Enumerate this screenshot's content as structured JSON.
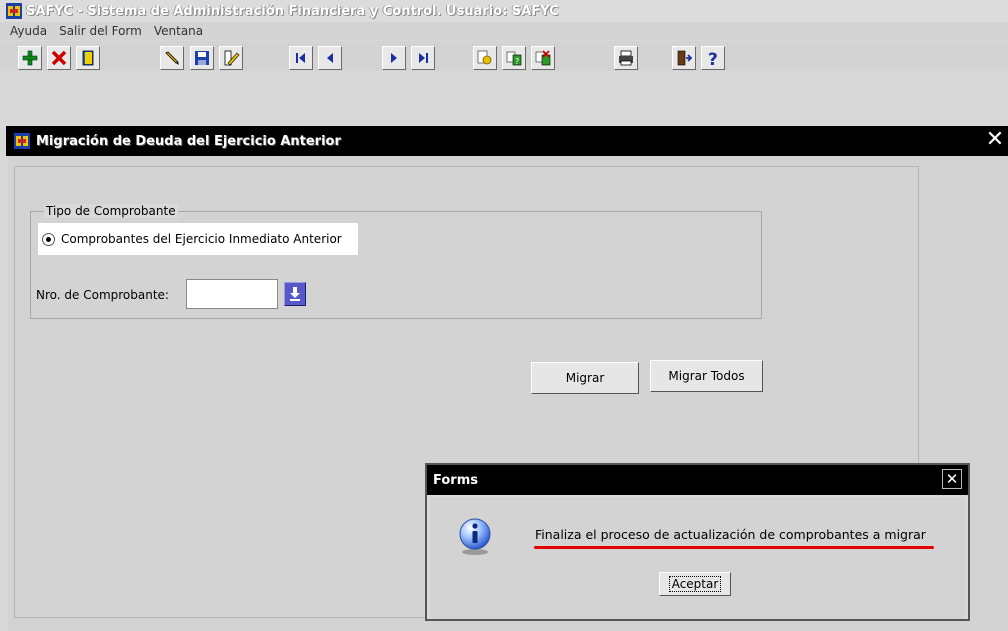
{
  "app": {
    "title": "SAFYC - Sistema de Administración Financiera y Control. Usuario: SAFYC"
  },
  "menu": [
    "Ayuda",
    "Salir del Form",
    "Ventana"
  ],
  "toolbar": {
    "buttons": [
      {
        "name": "insert-record",
        "icon": "green-plus-icon"
      },
      {
        "name": "delete-record",
        "icon": "red-x-icon"
      },
      {
        "name": "query",
        "icon": "book-icon"
      },
      {
        "name": "edit",
        "icon": "pencil-icon"
      },
      {
        "name": "save",
        "icon": "floppy-disk-icon"
      },
      {
        "name": "clear",
        "icon": "eraser-icon"
      },
      {
        "name": "first-record",
        "icon": "first-icon"
      },
      {
        "name": "previous-record",
        "icon": "previous-icon"
      },
      {
        "name": "next-record",
        "icon": "next-icon"
      },
      {
        "name": "last-record",
        "icon": "last-icon"
      },
      {
        "name": "enter-query",
        "icon": "query-icon"
      },
      {
        "name": "execute-query",
        "icon": "execute-query-icon"
      },
      {
        "name": "cancel-query",
        "icon": "cancel-query-icon"
      },
      {
        "name": "print",
        "icon": "printer-icon"
      },
      {
        "name": "exit",
        "icon": "exit-door-icon"
      },
      {
        "name": "help",
        "icon": "help-question-icon"
      }
    ]
  },
  "window": {
    "title": "Migración de Deuda del Ejercicio Anterior",
    "close": "✕"
  },
  "form": {
    "group_label": "Tipo de Comprobante",
    "radio_label": "Comprobantes del Ejercicio Inmediato Anterior",
    "nro_label": "Nro. de Comprobante:",
    "nro_value": "",
    "migrar_label": "Migrar",
    "migrar_todos_label": "Migrar Todos"
  },
  "dialog": {
    "title": "Forms",
    "message": "Finaliza el proceso de actualización de comprobantes a migrar",
    "ok_label": "Aceptar",
    "close": "✕"
  },
  "colors": {
    "titlebar_bg": "#000000",
    "highlight_underline": "#e00000",
    "lov_button": "#5858c8"
  }
}
